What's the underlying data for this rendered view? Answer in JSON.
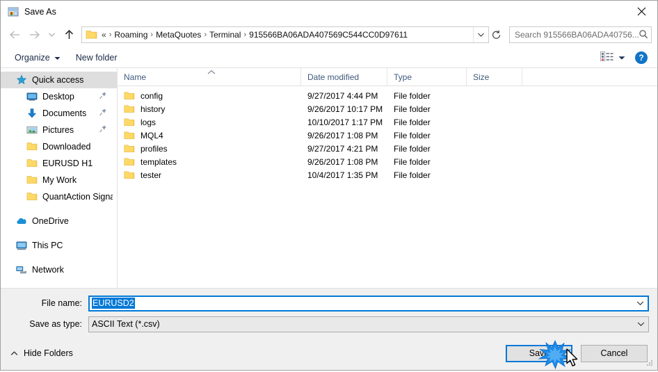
{
  "window": {
    "title": "Save As",
    "icon": "save-as-app-icon",
    "close_label": "×"
  },
  "nav": {
    "back_icon": "arrow-left-icon",
    "forward_icon": "arrow-right-icon",
    "recent_icon": "chevron-down-icon",
    "up_icon": "arrow-up-icon",
    "refresh_icon": "refresh-icon",
    "dropdown_icon": "chevron-down-icon",
    "folder_icon": "folder-icon",
    "breadcrumb_prefix": "«",
    "breadcrumbs": [
      "Roaming",
      "MetaQuotes",
      "Terminal",
      "915566BA06ADA407569C544CC0D97611"
    ],
    "separator": "›"
  },
  "search": {
    "placeholder": "Search 915566BA06ADA40756...",
    "icon": "search-icon"
  },
  "toolbar": {
    "organize_label": "Organize",
    "organize_caret": "caret-down-icon",
    "new_folder_label": "New folder",
    "view_icon": "details-view-icon",
    "view_caret": "caret-down-icon",
    "help_label": "?",
    "help_icon": "help-icon"
  },
  "sidebar": {
    "items": [
      {
        "label": "Quick access",
        "icon": "star-icon",
        "indent": 0,
        "selected": true,
        "pinned": false
      },
      {
        "label": "Desktop",
        "icon": "desktop-icon",
        "indent": 1,
        "selected": false,
        "pinned": true
      },
      {
        "label": "Documents",
        "icon": "documents-icon",
        "indent": 1,
        "selected": false,
        "pinned": true
      },
      {
        "label": "Pictures",
        "icon": "pictures-icon",
        "indent": 1,
        "selected": false,
        "pinned": true
      },
      {
        "label": "Downloaded",
        "icon": "folder-icon",
        "indent": 1,
        "selected": false,
        "pinned": false
      },
      {
        "label": "EURUSD H1",
        "icon": "folder-icon",
        "indent": 1,
        "selected": false,
        "pinned": false
      },
      {
        "label": "My Work",
        "icon": "folder-icon",
        "indent": 1,
        "selected": false,
        "pinned": false
      },
      {
        "label": "QuantAction Signal",
        "icon": "folder-icon",
        "indent": 1,
        "selected": false,
        "pinned": false
      },
      {
        "label": "OneDrive",
        "icon": "onedrive-icon",
        "indent": 0,
        "selected": false,
        "pinned": false,
        "gap_before": true
      },
      {
        "label": "This PC",
        "icon": "this-pc-icon",
        "indent": 0,
        "selected": false,
        "pinned": false,
        "gap_before": true
      },
      {
        "label": "Network",
        "icon": "network-icon",
        "indent": 0,
        "selected": false,
        "pinned": false,
        "gap_before": true
      }
    ]
  },
  "filelist": {
    "columns": [
      "Name",
      "Date modified",
      "Type",
      "Size"
    ],
    "sort_icon": "sort-ascending-icon",
    "rows": [
      {
        "name": "config",
        "date": "9/27/2017 4:44 PM",
        "type": "File folder",
        "size": ""
      },
      {
        "name": "history",
        "date": "9/26/2017 10:17 PM",
        "type": "File folder",
        "size": ""
      },
      {
        "name": "logs",
        "date": "10/10/2017 1:17 PM",
        "type": "File folder",
        "size": ""
      },
      {
        "name": "MQL4",
        "date": "9/26/2017 1:08 PM",
        "type": "File folder",
        "size": ""
      },
      {
        "name": "profiles",
        "date": "9/27/2017 4:21 PM",
        "type": "File folder",
        "size": ""
      },
      {
        "name": "templates",
        "date": "9/26/2017 1:08 PM",
        "type": "File folder",
        "size": ""
      },
      {
        "name": "tester",
        "date": "10/4/2017 1:35 PM",
        "type": "File folder",
        "size": ""
      }
    ]
  },
  "form": {
    "filename_label": "File name:",
    "filename_value": "EURUSD2",
    "filename_selected": true,
    "filetype_label": "Save as type:",
    "filetype_value": "ASCII Text (*.csv)",
    "dropdown_icon": "chevron-down-icon"
  },
  "footer": {
    "hide_folders_label": "Hide Folders",
    "hide_folders_icon": "caret-up-icon",
    "save_label": "Save",
    "cancel_label": "Cancel",
    "resize_grip_icon": "resize-grip-icon",
    "cursor_icon": "mouse-pointer-icon",
    "click_burst_icon": "click-burst-icon"
  },
  "colors": {
    "accent": "#0078d7",
    "folder_yellow": "#ffd966",
    "header_text": "#3f5a7d",
    "selection_grey": "#dedede",
    "help_blue": "#1175c7"
  }
}
